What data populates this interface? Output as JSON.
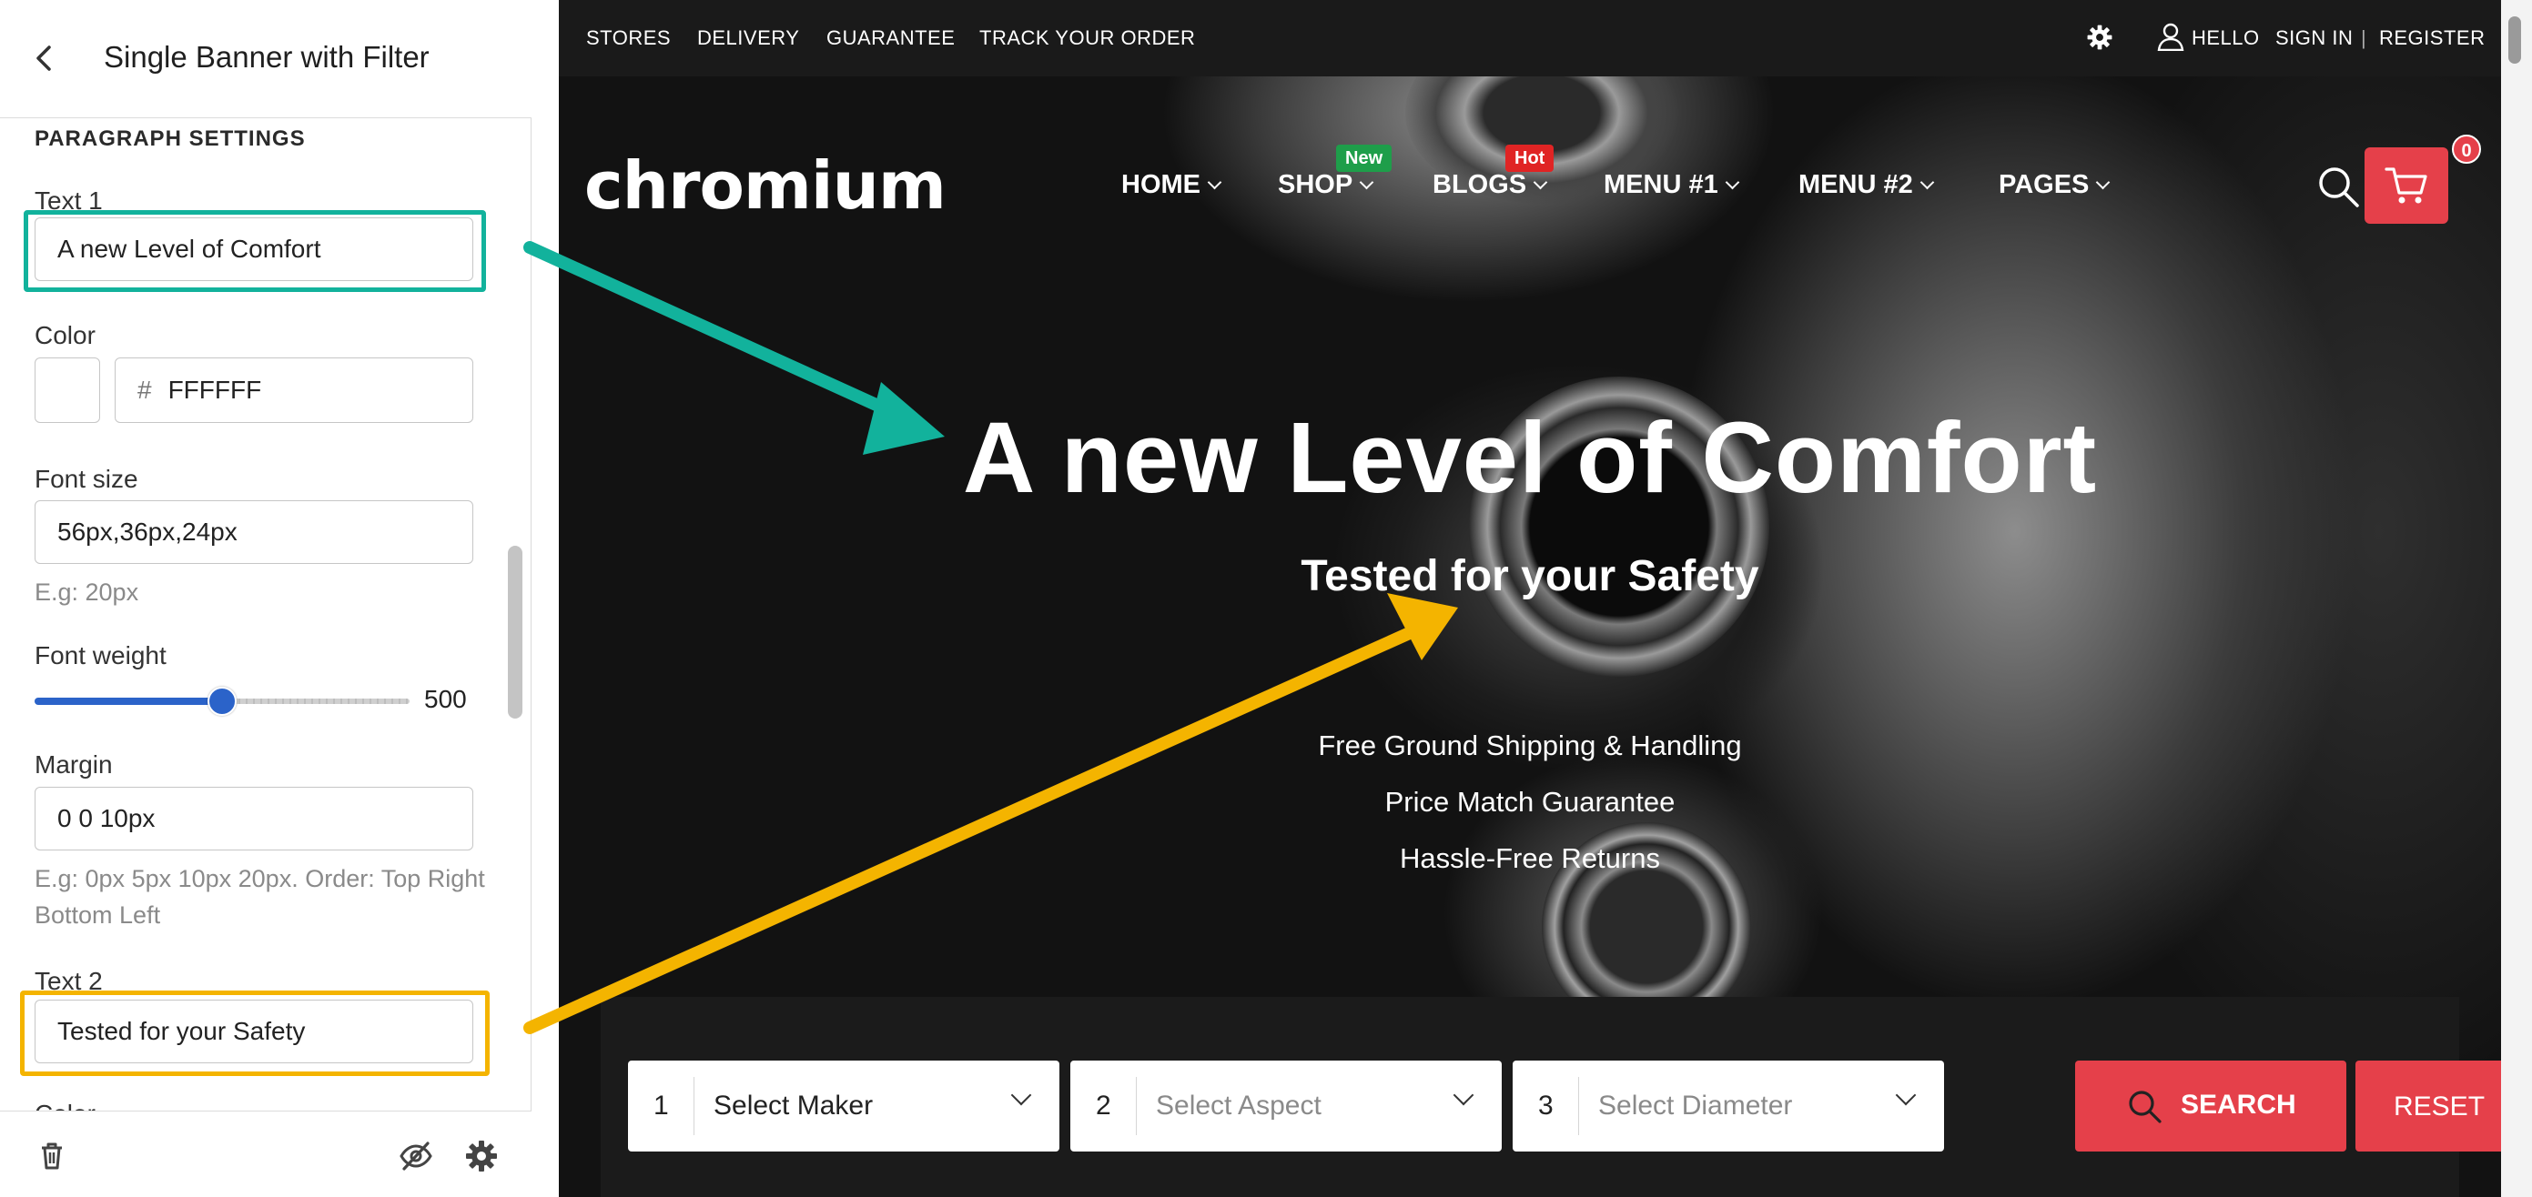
{
  "panel": {
    "title": "Single Banner with Filter",
    "section_title": "PARAGRAPH SETTINGS",
    "text1": {
      "label": "Text 1",
      "value": "A new Level of Comfort"
    },
    "color": {
      "label": "Color",
      "hash": "#",
      "hex": "FFFFFF"
    },
    "font_size": {
      "label": "Font size",
      "value": "56px,36px,24px",
      "hint": "E.g: 20px"
    },
    "font_weight": {
      "label": "Font weight",
      "value": "500",
      "slider_fraction": 0.5
    },
    "margin": {
      "label": "Margin",
      "value": "0 0 10px",
      "hint": "E.g: 0px 5px 10px 20px. Order: Top Right Bottom Left"
    },
    "text2": {
      "label": "Text 2",
      "value": "Tested for your Safety"
    },
    "next_label": "Color",
    "footer": {
      "delete_icon": "trash-icon",
      "hide_icon": "eye-off-icon",
      "settings_icon": "gear-icon"
    }
  },
  "store": {
    "topbar": {
      "links": [
        "STORES",
        "DELIVERY",
        "GUARANTEE",
        "TRACK YOUR ORDER"
      ],
      "hello": "HELLO",
      "sign_in": "SIGN IN",
      "separator": "|",
      "register": "REGISTER"
    },
    "logo": "chromium",
    "nav": [
      {
        "label": "HOME"
      },
      {
        "label": "SHOP",
        "badge": "New",
        "badge_color": "#1e9e4a"
      },
      {
        "label": "BLOGS",
        "badge": "Hot",
        "badge_color": "#e02424"
      },
      {
        "label": "MENU #1"
      },
      {
        "label": "MENU #2"
      },
      {
        "label": "PAGES"
      }
    ],
    "cart_count": "0",
    "hero": {
      "headline": "A new Level of Comfort",
      "subhead": "Tested for your Safety",
      "features": [
        "Free Ground Shipping & Handling",
        "Price Match Guarantee",
        "Hassle-Free Returns"
      ]
    },
    "filter": {
      "selects": [
        {
          "num": "1",
          "text": "Select Maker"
        },
        {
          "num": "2",
          "text": "Select Aspect"
        },
        {
          "num": "3",
          "text": "Select Diameter"
        }
      ],
      "search_label": "SEARCH",
      "reset_label": "RESET"
    }
  },
  "colors": {
    "accent_red": "#e5404a",
    "highlight_teal": "#12b29c",
    "highlight_yellow": "#f4b400",
    "slider_blue": "#2b63c9"
  }
}
